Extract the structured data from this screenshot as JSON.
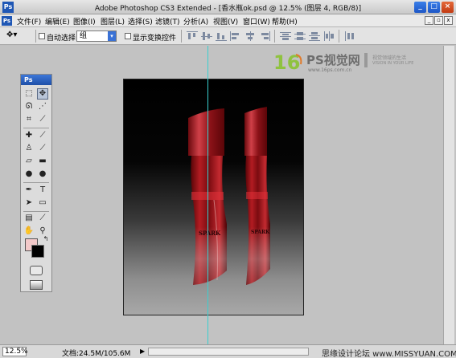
{
  "window": {
    "title": "Adobe Photoshop CS3 Extended - [香水瓶ok.psd @ 12.5% (图层 4, RGB/8)]",
    "app_icon": "Ps",
    "controls": [
      "minimize-icon",
      "maximize-icon",
      "close-icon"
    ]
  },
  "menubar": {
    "icon": "Ps",
    "items": [
      "文件(F)",
      "编辑(E)",
      "图像(I)",
      "图层(L)",
      "选择(S)",
      "滤镜(T)",
      "分析(A)",
      "视图(V)",
      "窗口(W)",
      "帮助(H)"
    ]
  },
  "options": {
    "auto_select_label": "自动选择:",
    "auto_select_value": "组",
    "show_transform_label": "显示变换控件"
  },
  "toolbox": {
    "title": "Ps",
    "fg_color": "#f3c9c9",
    "bg_color": "#000000"
  },
  "watermark": {
    "logo_text": "16",
    "brand": "PS视觉网",
    "url": "www.16ps.com.cn",
    "side_line1": "视觉领域的生活",
    "side_line2": "VISION IN YOUR LIFE"
  },
  "canvas": {
    "bottle_label": "SPARK",
    "guide_color": "#39d0d0"
  },
  "status": {
    "zoom": "12.5%",
    "doc_info": "文档:24.5M/105.6M",
    "bottom_watermark": "思缘设计论坛 www.MISSYUAN.COM"
  }
}
